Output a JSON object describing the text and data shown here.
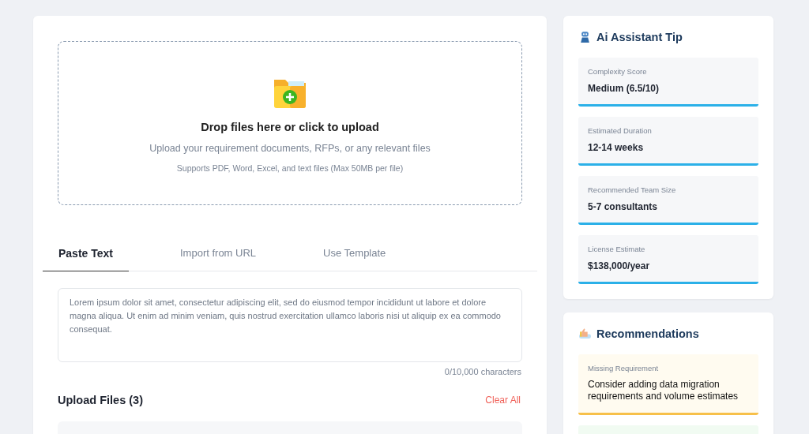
{
  "upload": {
    "title": "Drop files here or click to upload",
    "subtitle": "Upload your requirement documents, RFPs, or any relevant files",
    "note": "Supports PDF, Word, Excel, and text files (Max 50MB per file)"
  },
  "tabs": [
    {
      "label": "Paste Text",
      "selected": true
    },
    {
      "label": "Import from URL",
      "selected": false
    },
    {
      "label": "Use Template",
      "selected": false
    }
  ],
  "text_input": {
    "placeholder": "Lorem ipsum dolor sit amet, consectetur adipiscing elit, sed do eiusmod tempor incididunt ut labore et dolore magna aliqua. Ut enim ad minim veniam, quis nostrud exercitation ullamco laboris nisi ut aliquip ex ea commodo consequat.",
    "counter": "0/10,000 characters"
  },
  "files": {
    "title": "Upload Files (3)",
    "clear": "Clear All"
  },
  "tip": {
    "title": "Ai Assistant Tip",
    "stats": [
      {
        "label": "Complexity Score",
        "value": "Medium (6.5/10)"
      },
      {
        "label": "Estimated Duration",
        "value": "12-14 weeks"
      },
      {
        "label": "Recommended Team Size",
        "value": "5-7 consultants"
      },
      {
        "label": "License Estimate",
        "value": "$138,000/year"
      }
    ]
  },
  "recommendations": {
    "title": "Recommendations",
    "items": [
      {
        "label": "Missing Requirement",
        "text": "Consider adding data migration requirements and volume estimates",
        "color": "#fffbf0",
        "kind": "warning"
      },
      {
        "color": "#f1fbf2",
        "kind": "success"
      }
    ]
  }
}
